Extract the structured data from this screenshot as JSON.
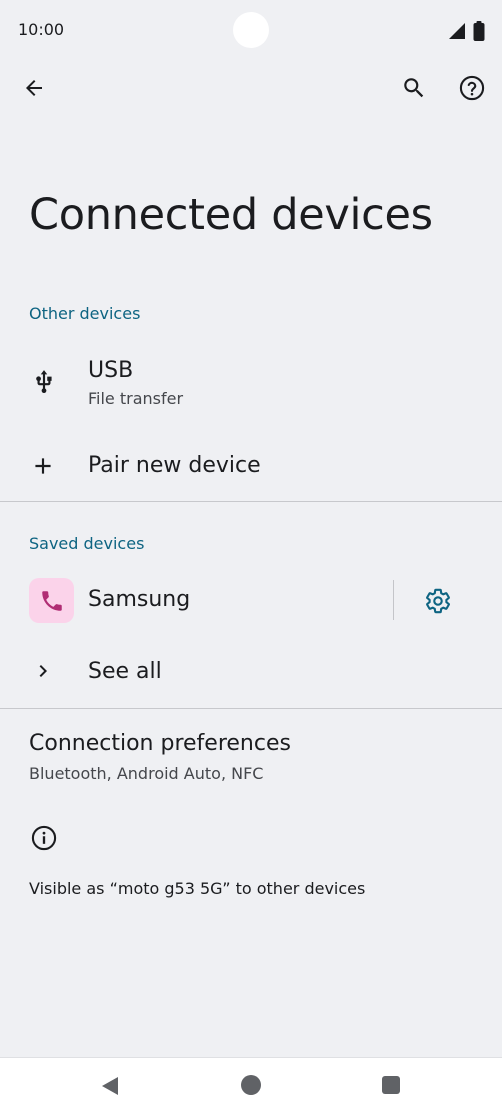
{
  "status_bar": {
    "time": "10:00"
  },
  "page": {
    "title": "Connected devices"
  },
  "other_devices": {
    "header": "Other devices",
    "usb_title": "USB",
    "usb_subtitle": "File transfer",
    "pair_new_label": "Pair new device"
  },
  "saved_devices": {
    "header": "Saved devices",
    "device_name": "Samsung",
    "see_all_label": "See all"
  },
  "connection_preferences": {
    "title": "Connection preferences",
    "subtitle": "Bluetooth, Android Auto, NFC"
  },
  "footer": {
    "visible_as": "Visible as “moto g53 5G” to other devices"
  },
  "colors": {
    "accent": "#0e6482",
    "background": "#eff0f3",
    "device_avatar_bg": "#fbd3ea",
    "device_avatar_icon": "#b02d74"
  }
}
